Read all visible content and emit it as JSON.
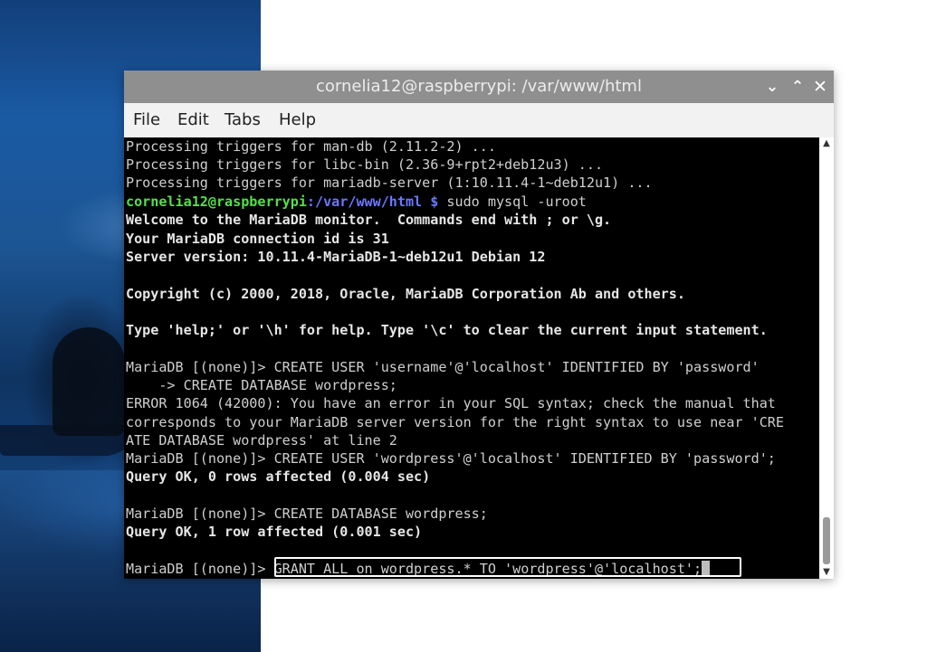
{
  "window": {
    "title": "cornelia12@raspberrypi: /var/www/html",
    "controls": {
      "minimize": "⌄",
      "maximize": "⌃",
      "close": "✕"
    }
  },
  "menubar": {
    "file": "File",
    "edit": "Edit",
    "tabs": "Tabs",
    "help": "Help"
  },
  "terminal": {
    "lines": [
      "Processing triggers for man-db (2.11.2-2) ...",
      "Processing triggers for libc-bin (2.36-9+rpt2+deb12u3) ...",
      "Processing triggers for mariadb-server (1:10.11.4-1~deb12u1) ...",
      "",
      "Welcome to the MariaDB monitor.  Commands end with ; or \\g.",
      "Your MariaDB connection id is 31",
      "Server version: 10.11.4-MariaDB-1~deb12u1 Debian 12",
      "",
      "Copyright (c) 2000, 2018, Oracle, MariaDB Corporation Ab and others.",
      "",
      "Type 'help;' or '\\h' for help. Type '\\c' to clear the current input statement.",
      "",
      "MariaDB [(none)]> CREATE USER 'username'@'localhost' IDENTIFIED BY 'password'",
      "    -> CREATE DATABASE wordpress;",
      "ERROR 1064 (42000): You have an error in your SQL syntax; check the manual that",
      "corresponds to your MariaDB server version for the right syntax to use near 'CRE",
      "ATE DATABASE wordpress' at line 2",
      "MariaDB [(none)]> CREATE USER 'wordpress'@'localhost' IDENTIFIED BY 'password';",
      "Query OK, 0 rows affected (0.004 sec)",
      "",
      "MariaDB [(none)]> CREATE DATABASE wordpress;",
      "Query OK, 1 row affected (0.001 sec)",
      "",
      ""
    ],
    "prompt": {
      "user_host": "cornelia12@raspberrypi",
      "path": ":/var/www/html $",
      "command": " sudo mysql -uroot"
    },
    "current_prompt": "MariaDB [(none)]>",
    "current_input": " GRANT ALL on wordpress.* TO 'wordpress'@'localhost';"
  },
  "scrollbar": {
    "up_arrow": "▲",
    "down_arrow": "▼",
    "position": 0.94
  },
  "colors": {
    "titlebar": "#8f8f8f",
    "menubar": "#f2f2f2",
    "terminal_bg": "#000000",
    "terminal_text": "#cfcfcf",
    "prompt_user": "#55e04a",
    "prompt_path": "#6a78ff"
  }
}
